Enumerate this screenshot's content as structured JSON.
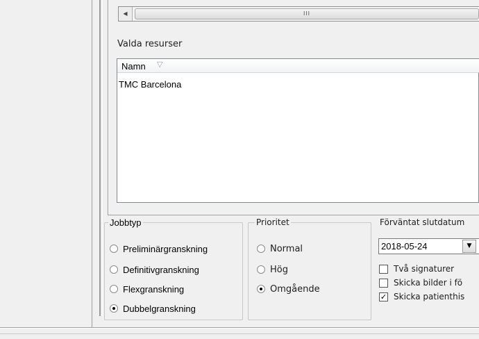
{
  "resources": {
    "label": "Valda resurser",
    "columns": [
      "Namn"
    ],
    "rows": [
      "TMC Barcelona"
    ]
  },
  "scrollbar": {
    "grip": "III"
  },
  "jobbtyp": {
    "title": "Jobbtyp",
    "options": [
      {
        "label": "Preliminärgranskning",
        "checked": false
      },
      {
        "label": "Definitivgranskning",
        "checked": false
      },
      {
        "label": "Flexgranskning",
        "checked": false
      },
      {
        "label": "Dubbelgranskning",
        "checked": true
      }
    ]
  },
  "prioritet": {
    "title": "Prioritet",
    "options": [
      {
        "label": "Normal",
        "checked": false
      },
      {
        "label": "Hög",
        "checked": false
      },
      {
        "label": "Omgående",
        "checked": true
      }
    ]
  },
  "slutdatum": {
    "label": "Förväntat slutdatum",
    "value": "2018-05-24"
  },
  "checks": [
    {
      "label": "Två signaturer",
      "checked": false
    },
    {
      "label": "Skicka bilder i fö",
      "checked": false
    },
    {
      "label": "Skicka patienthis",
      "checked": true
    }
  ]
}
